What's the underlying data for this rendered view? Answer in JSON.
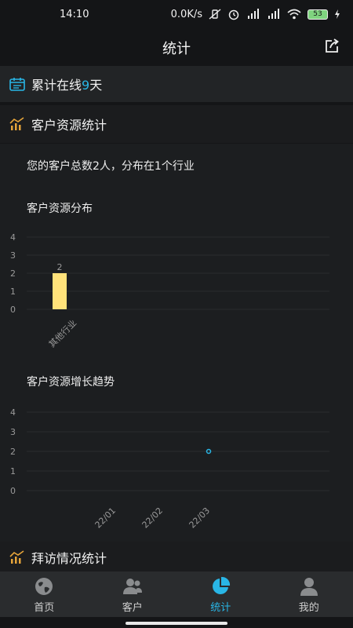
{
  "status": {
    "time": "14:10",
    "network_speed": "0.0K/s",
    "battery_level": "53"
  },
  "header": {
    "title": "统计"
  },
  "online": {
    "prefix": "累计在线",
    "days": "9",
    "suffix": "天"
  },
  "customer_section": {
    "title": "客户资源统计",
    "summary": "您的客户总数2人，分布在1个行业",
    "distribution_title": "客户资源分布",
    "growth_title": "客户资源增长趋势"
  },
  "visit_section": {
    "title": "拜访情况统计"
  },
  "tabs": [
    {
      "label": "首页",
      "icon": "globe-icon",
      "active": false
    },
    {
      "label": "客户",
      "icon": "contacts-icon",
      "active": false
    },
    {
      "label": "统计",
      "icon": "pie-chart-icon",
      "active": true
    },
    {
      "label": "我的",
      "icon": "person-icon",
      "active": false
    }
  ],
  "colors": {
    "accent": "#29b6e6",
    "bar": "#ffe27a",
    "background": "#141517",
    "card": "#1c1e20"
  },
  "chart_data": [
    {
      "type": "bar",
      "title": "客户资源分布",
      "categories": [
        "其他行业"
      ],
      "values": [
        2
      ],
      "data_labels": [
        "2"
      ],
      "yticks": [
        0,
        1,
        2,
        3,
        4
      ],
      "ylim": [
        0,
        4
      ]
    },
    {
      "type": "scatter",
      "title": "客户资源增长趋势",
      "categories": [
        "22/01",
        "22/02",
        "22/03"
      ],
      "x": [
        "22/03"
      ],
      "values": [
        2
      ],
      "yticks": [
        0,
        1,
        2,
        3,
        4
      ],
      "ylim": [
        0,
        4
      ]
    }
  ]
}
